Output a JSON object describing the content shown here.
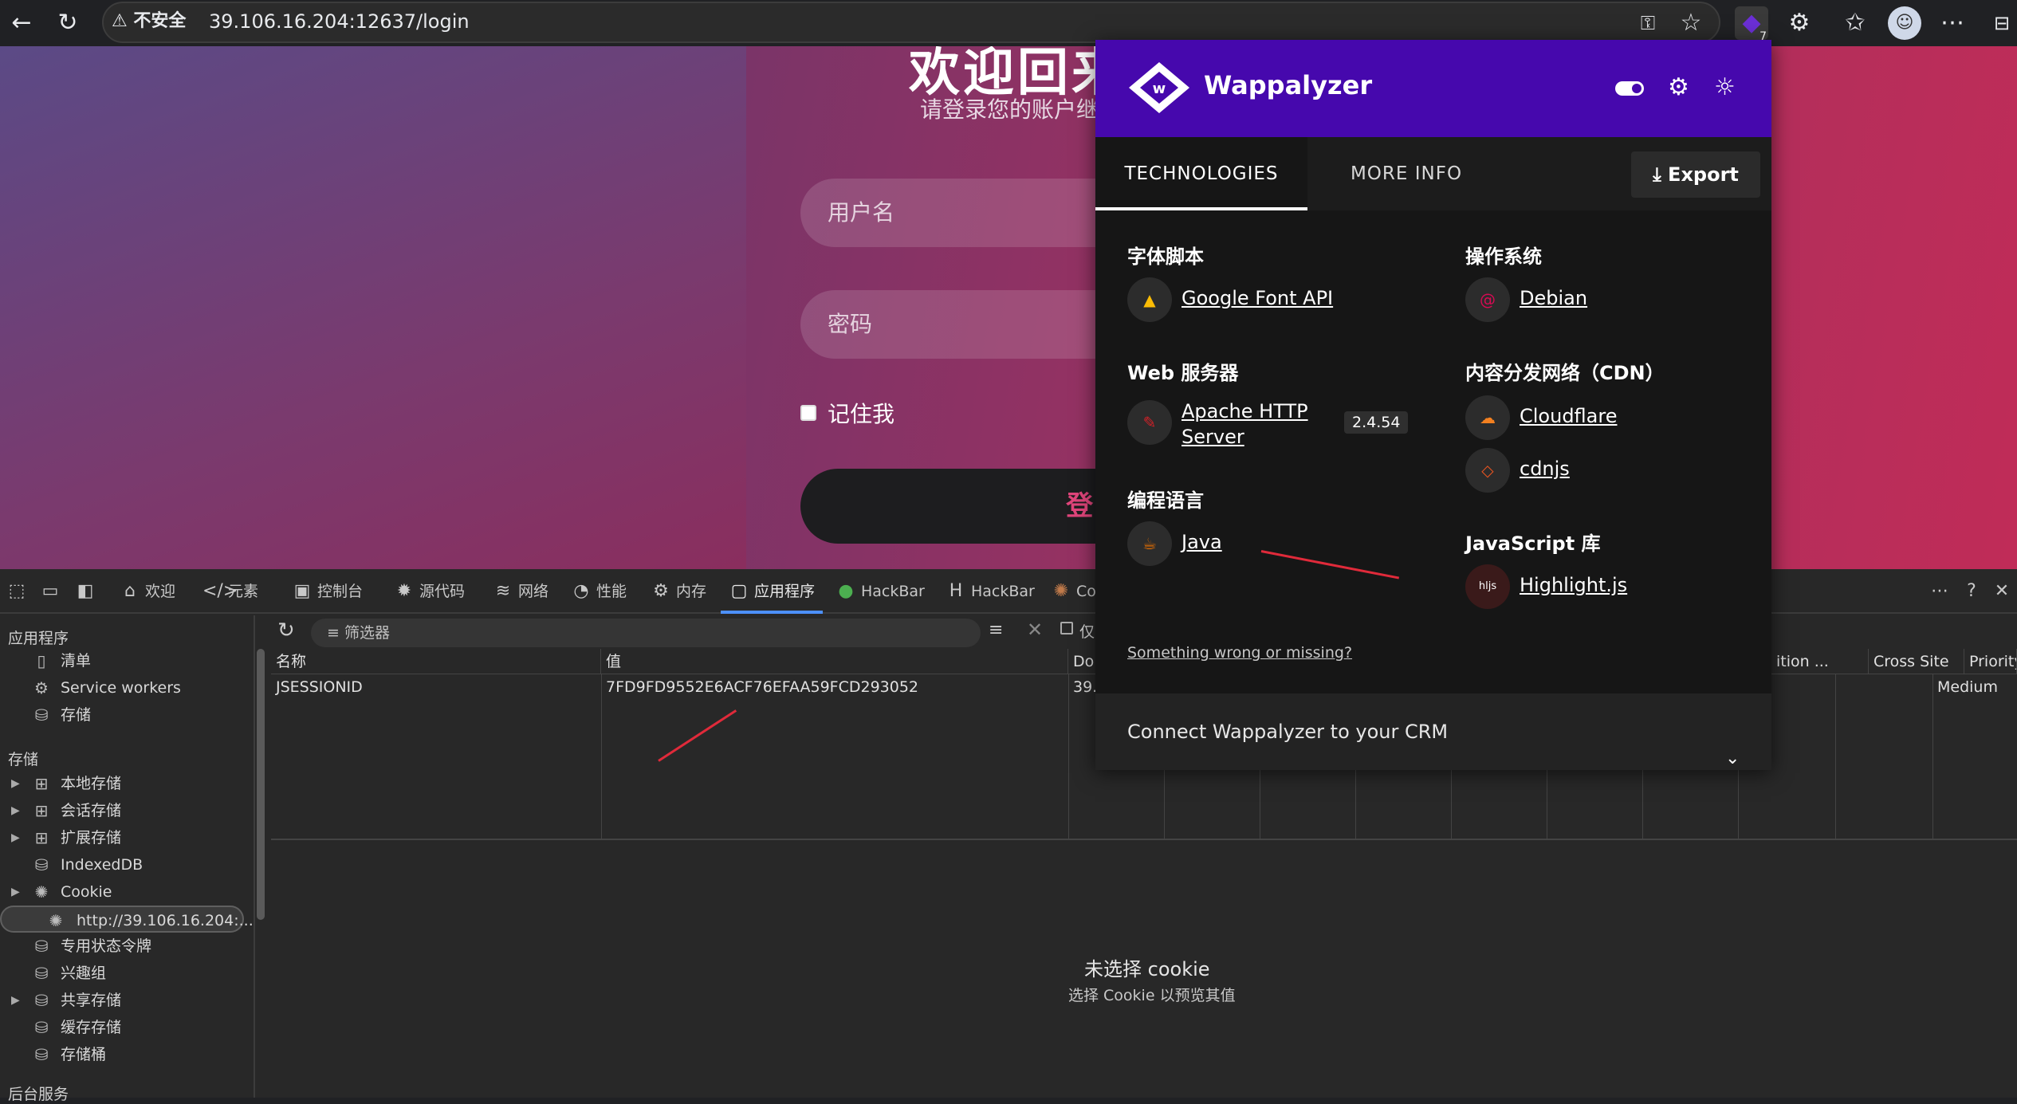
{
  "browser": {
    "security_label": "不安全",
    "url": "39.106.16.204:12637/login",
    "extension_badge": "7"
  },
  "login": {
    "title": "欢迎回来",
    "subtitle": "请登录您的账户继",
    "username_placeholder": "用户名",
    "password_placeholder": "密码",
    "remember_label": "记住我",
    "submit_label": "登 录"
  },
  "devtools": {
    "tabs": [
      {
        "label": "欢迎",
        "icon": "home-icon"
      },
      {
        "label": "元素",
        "icon": "code-icon"
      },
      {
        "label": "控制台",
        "icon": "console-icon"
      },
      {
        "label": "源代码",
        "icon": "bug-icon"
      },
      {
        "label": "网络",
        "icon": "wifi-icon"
      },
      {
        "label": "性能",
        "icon": "gauge-icon"
      },
      {
        "label": "内存",
        "icon": "gear-icon"
      },
      {
        "label": "应用程序",
        "icon": "app-icon"
      },
      {
        "label": "HackBar",
        "icon": "hackbar-icon"
      },
      {
        "label": "HackBar",
        "icon": "hackbar-h-icon"
      },
      {
        "label": "Co",
        "icon": "cookie-icon"
      }
    ],
    "sidebar": {
      "section_app": "应用程序",
      "app_items": [
        "清单",
        "Service workers",
        "存储"
      ],
      "section_storage": "存储",
      "storage_items": [
        "本地存储",
        "会话存储",
        "扩展存储",
        "IndexedDB",
        "Cookie"
      ],
      "cookie_origin": "http://39.106.16.204:...",
      "more_items": [
        "专用状态令牌",
        "兴趣组",
        "共享存储",
        "缓存存储",
        "存储桶"
      ],
      "section_bg": "后台服务"
    },
    "filter_placeholder": "筛选器",
    "only_label": "仅",
    "columns": [
      "名称",
      "值",
      "Do",
      "ition ...",
      "Cross Site",
      "Priority"
    ],
    "row": {
      "name": "JSESSIONID",
      "value": "7FD9FD9552E6ACF76EFAA59FCD293052",
      "domain": "39.",
      "priority": "Medium"
    },
    "empty_title": "未选择 cookie",
    "empty_sub": "选择 Cookie 以预览其值"
  },
  "wappalyzer": {
    "brand": "Wappalyzer",
    "tab_tech": "TECHNOLOGIES",
    "tab_more": "MORE INFO",
    "export_label": "Export",
    "categories": {
      "font": {
        "title": "字体脚本",
        "items": [
          "Google Font API"
        ]
      },
      "os": {
        "title": "操作系统",
        "items": [
          "Debian"
        ]
      },
      "web": {
        "title": "Web 服务器",
        "items": [
          "Apache HTTP Server"
        ],
        "version": "2.4.54"
      },
      "cdn": {
        "title": "内容分发网络（CDN）",
        "items": [
          "Cloudflare",
          "cdnjs"
        ]
      },
      "lang": {
        "title": "编程语言",
        "items": [
          "Java"
        ]
      },
      "js": {
        "title": "JavaScript 库",
        "items": [
          "Highlight.js"
        ]
      }
    },
    "wrong_link": "Something wrong or missing?",
    "crm_label": "Connect Wappalyzer to your CRM"
  }
}
